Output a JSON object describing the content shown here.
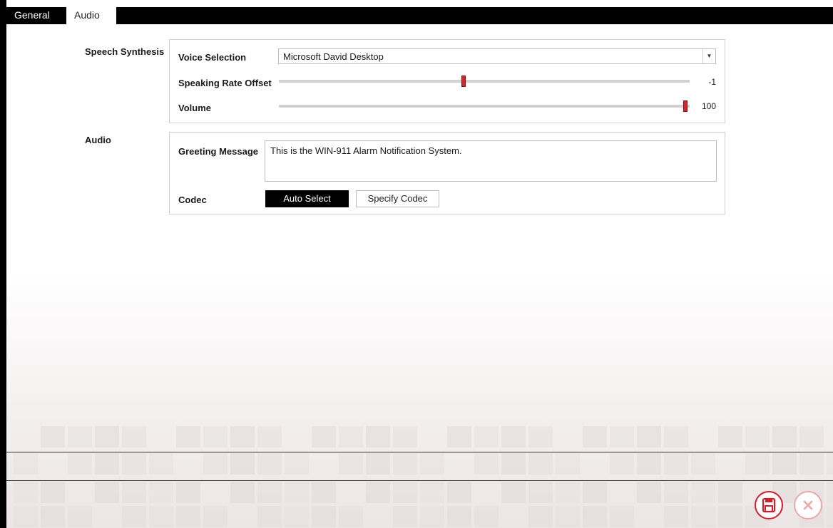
{
  "tabs": {
    "general": "General",
    "audio": "Audio"
  },
  "speech": {
    "section_label": "Speech Synthesis",
    "voice_label": "Voice Selection",
    "voice_value": "Microsoft David Desktop",
    "rate_label": "Speaking Rate Offset",
    "rate_value": "-1",
    "rate_fraction": 0.45,
    "volume_label": "Volume",
    "volume_value": "100",
    "volume_fraction": 1.0
  },
  "audio": {
    "section_label": "Audio",
    "greeting_label": "Greeting Message",
    "greeting_value": "This is the WIN-911 Alarm Notification System.",
    "codec_label": "Codec",
    "auto_select_label": "Auto Select",
    "specify_codec_label": "Specify Codec"
  },
  "actions": {
    "save_icon": "save-icon",
    "cancel_icon": "close-icon"
  },
  "colors": {
    "accent": "#d21f2a",
    "slider_thumb": "#d6252b",
    "tab_bar": "#000000"
  }
}
